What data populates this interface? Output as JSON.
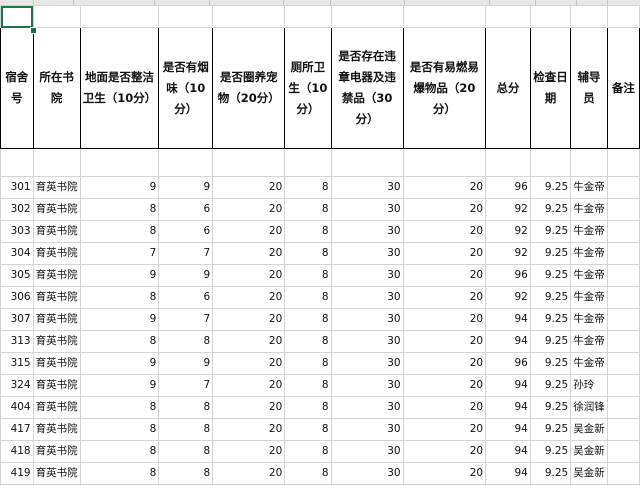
{
  "headers": {
    "dorm_no": "宿舍号",
    "college": "所在书院",
    "floor_clean": "地面是否整洁卫生（10分）",
    "smoke": "是否有烟味（10分）",
    "pets": "是否圈养宠物（20分）",
    "toilet": "厕所卫生（10分）",
    "appliances": "是否存在违章电器及违禁品（30分）",
    "flammables": "是否有易燃易爆物品（20分）",
    "total": "总分",
    "date": "检查日期",
    "counselor": "辅导员",
    "remarks": "备注"
  },
  "rows": [
    {
      "dorm": "301",
      "college": "育英书院",
      "floor": "9",
      "smoke": "9",
      "pets": "20",
      "toilet": "8",
      "appliances": "30",
      "flammables": "20",
      "total": "96",
      "date": "9.25",
      "counselor": "牛金帝"
    },
    {
      "dorm": "302",
      "college": "育英书院",
      "floor": "8",
      "smoke": "6",
      "pets": "20",
      "toilet": "8",
      "appliances": "30",
      "flammables": "20",
      "total": "92",
      "date": "9.25",
      "counselor": "牛金帝"
    },
    {
      "dorm": "303",
      "college": "育英书院",
      "floor": "8",
      "smoke": "6",
      "pets": "20",
      "toilet": "8",
      "appliances": "30",
      "flammables": "20",
      "total": "92",
      "date": "9.25",
      "counselor": "牛金帝"
    },
    {
      "dorm": "304",
      "college": "育英书院",
      "floor": "7",
      "smoke": "7",
      "pets": "20",
      "toilet": "8",
      "appliances": "30",
      "flammables": "20",
      "total": "92",
      "date": "9.25",
      "counselor": "牛金帝"
    },
    {
      "dorm": "305",
      "college": "育英书院",
      "floor": "9",
      "smoke": "9",
      "pets": "20",
      "toilet": "8",
      "appliances": "30",
      "flammables": "20",
      "total": "96",
      "date": "9.25",
      "counselor": "牛金帝"
    },
    {
      "dorm": "306",
      "college": "育英书院",
      "floor": "8",
      "smoke": "6",
      "pets": "20",
      "toilet": "8",
      "appliances": "30",
      "flammables": "20",
      "total": "92",
      "date": "9.25",
      "counselor": "牛金帝"
    },
    {
      "dorm": "307",
      "college": "育英书院",
      "floor": "9",
      "smoke": "7",
      "pets": "20",
      "toilet": "8",
      "appliances": "30",
      "flammables": "20",
      "total": "94",
      "date": "9.25",
      "counselor": "牛金帝"
    },
    {
      "dorm": "313",
      "college": "育英书院",
      "floor": "8",
      "smoke": "8",
      "pets": "20",
      "toilet": "8",
      "appliances": "30",
      "flammables": "20",
      "total": "94",
      "date": "9.25",
      "counselor": "牛金帝"
    },
    {
      "dorm": "315",
      "college": "育英书院",
      "floor": "9",
      "smoke": "9",
      "pets": "20",
      "toilet": "8",
      "appliances": "30",
      "flammables": "20",
      "total": "96",
      "date": "9.25",
      "counselor": "牛金帝"
    },
    {
      "dorm": "324",
      "college": "育英书院",
      "floor": "9",
      "smoke": "7",
      "pets": "20",
      "toilet": "8",
      "appliances": "30",
      "flammables": "20",
      "total": "94",
      "date": "9.25",
      "counselor": "孙玲"
    },
    {
      "dorm": "404",
      "college": "育英书院",
      "floor": "8",
      "smoke": "8",
      "pets": "20",
      "toilet": "8",
      "appliances": "30",
      "flammables": "20",
      "total": "94",
      "date": "9.25",
      "counselor": "徐润锋"
    },
    {
      "dorm": "417",
      "college": "育英书院",
      "floor": "8",
      "smoke": "8",
      "pets": "20",
      "toilet": "8",
      "appliances": "30",
      "flammables": "20",
      "total": "94",
      "date": "9.25",
      "counselor": "吴金新"
    },
    {
      "dorm": "418",
      "college": "育英书院",
      "floor": "8",
      "smoke": "8",
      "pets": "20",
      "toilet": "8",
      "appliances": "30",
      "flammables": "20",
      "total": "94",
      "date": "9.25",
      "counselor": "吴金新"
    },
    {
      "dorm": "419",
      "college": "育英书院",
      "floor": "8",
      "smoke": "8",
      "pets": "20",
      "toilet": "8",
      "appliances": "30",
      "flammables": "20",
      "total": "94",
      "date": "9.25",
      "counselor": "吴金新"
    }
  ]
}
